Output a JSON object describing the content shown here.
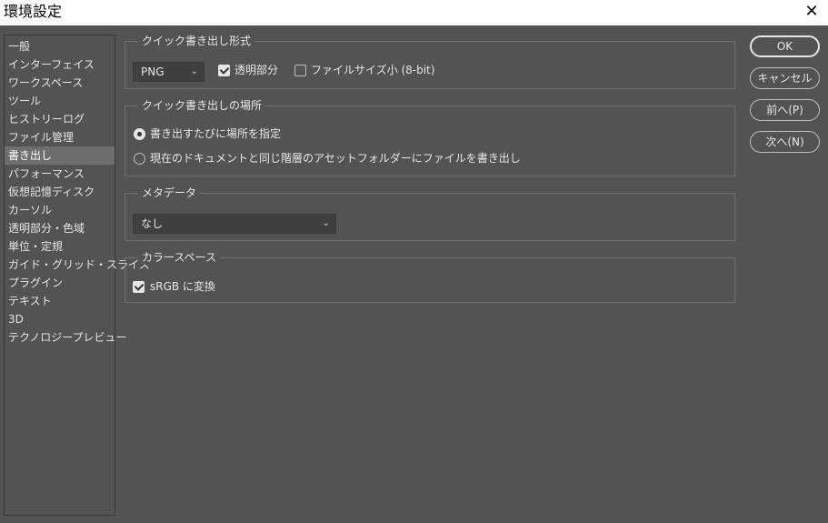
{
  "window": {
    "title": "環境設定",
    "close_glyph": "✕"
  },
  "sidebar": {
    "items": [
      {
        "label": "一般"
      },
      {
        "label": "インターフェイス"
      },
      {
        "label": "ワークスペース"
      },
      {
        "label": "ツール"
      },
      {
        "label": "ヒストリーログ"
      },
      {
        "label": "ファイル管理"
      },
      {
        "label": "書き出し",
        "selected": true
      },
      {
        "label": "パフォーマンス"
      },
      {
        "label": "仮想記憶ディスク"
      },
      {
        "label": "カーソル"
      },
      {
        "label": "透明部分・色域"
      },
      {
        "label": "単位・定規"
      },
      {
        "label": "ガイド・グリッド・スライス"
      },
      {
        "label": "プラグイン"
      },
      {
        "label": "テキスト"
      },
      {
        "label": "3D"
      },
      {
        "label": "テクノロジープレビュー"
      }
    ]
  },
  "quick_export_format": {
    "legend": "クイック書き出し形式",
    "format_value": "PNG",
    "transparency_label": "透明部分",
    "transparency_checked": true,
    "small_file_label": "ファイルサイズ小 (8-bit)",
    "small_file_checked": false
  },
  "quick_export_location": {
    "legend": "クイック書き出しの場所",
    "option_ask_label": "書き出すたびに場所を指定",
    "option_ask_selected": true,
    "option_folder_label": "現在のドキュメントと同じ階層のアセットフォルダーにファイルを書き出し",
    "option_folder_selected": false
  },
  "metadata": {
    "legend": "メタデータ",
    "value": "なし"
  },
  "color_space": {
    "legend": "カラースペース",
    "srgb_label": "sRGB に変換",
    "srgb_checked": true
  },
  "buttons": {
    "ok": "OK",
    "cancel": "キャンセル",
    "prev": "前へ(P)",
    "next": "次へ(N)"
  },
  "icons": {
    "chevron": "⌄"
  }
}
